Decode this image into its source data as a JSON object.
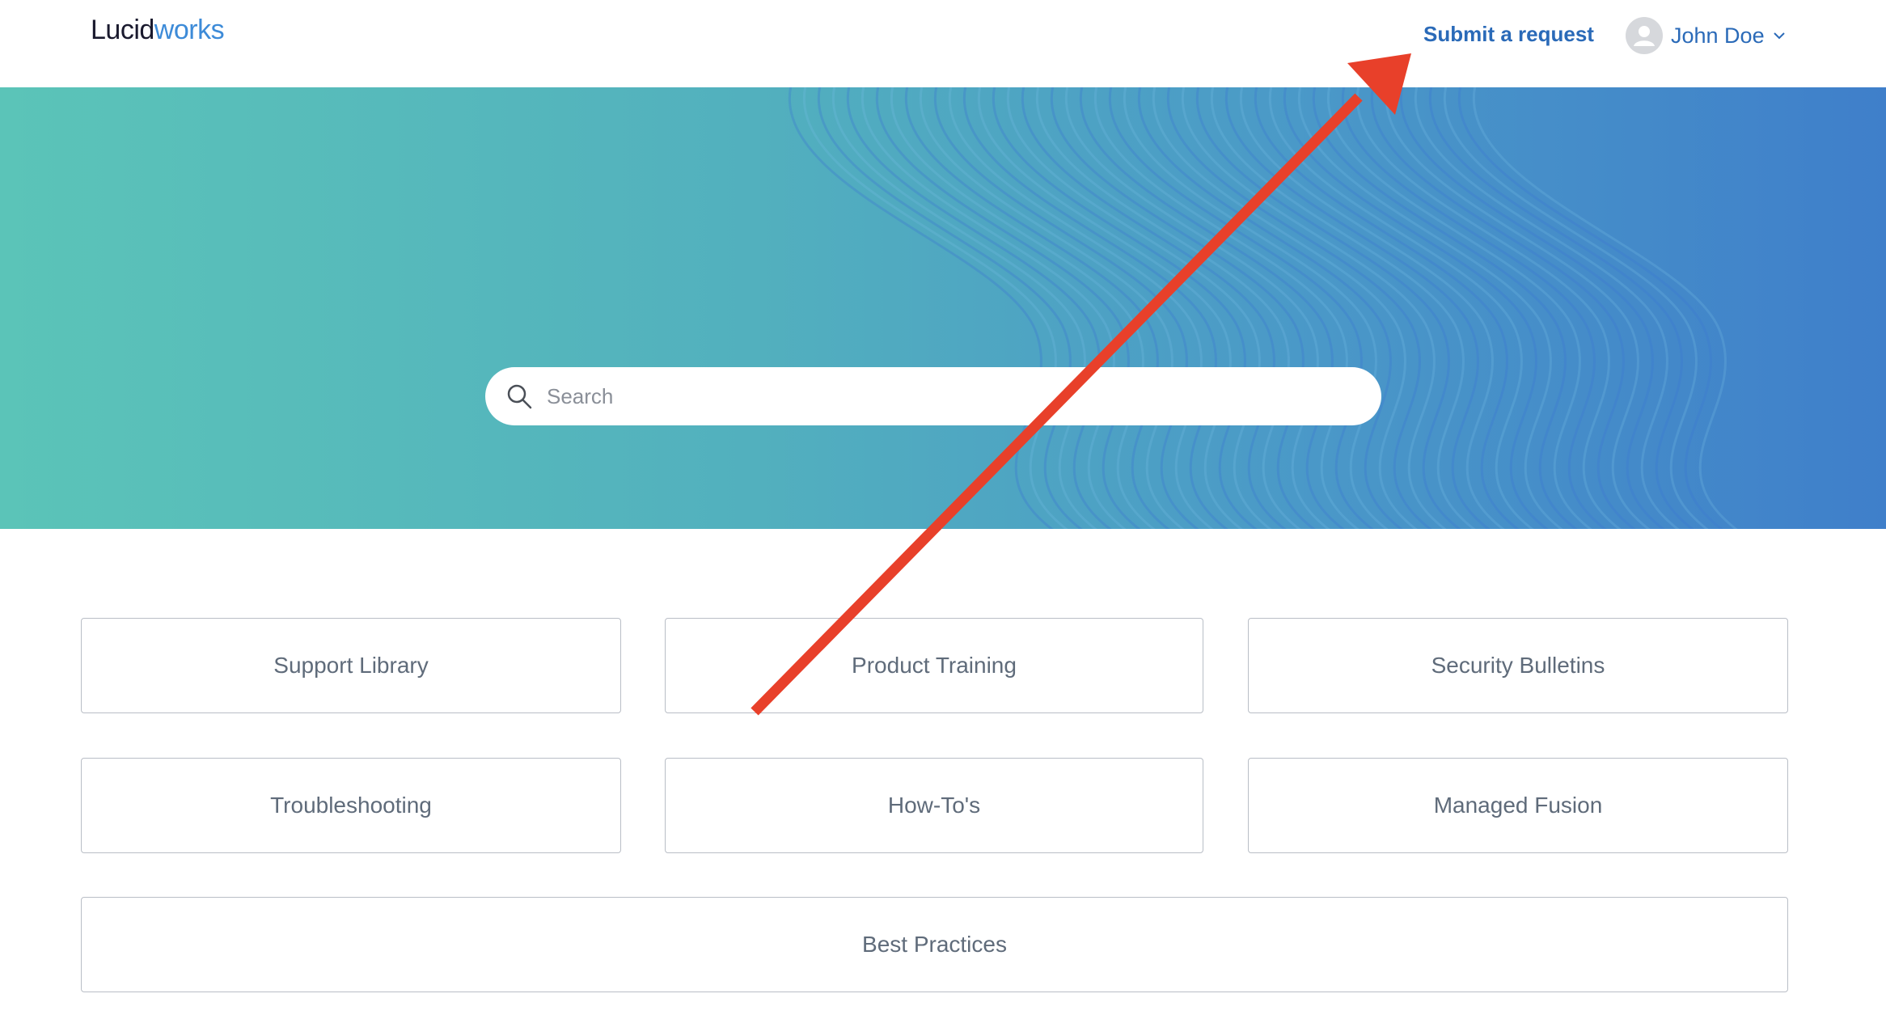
{
  "header": {
    "logo_part1": "Lucid",
    "logo_part2": "works",
    "submit_label": "Submit a request",
    "user_name": "John Doe",
    "user_icon": "person-icon",
    "dropdown_icon": "chevron-down-icon"
  },
  "hero": {
    "search_placeholder": "Search",
    "search_icon": "magnifier-icon"
  },
  "categories": [
    "Support Library",
    "Product Training",
    "Security Bulletins",
    "Troubleshooting",
    "How-To's",
    "Managed Fusion",
    "Best Practices"
  ],
  "colors": {
    "brand_dark": "#1a1a2e",
    "brand_blue": "#3d8bd8",
    "link_blue": "#2a6ab8",
    "hero_start": "#5bc4b8",
    "hero_end": "#3f7fca",
    "annotation_arrow": "#e8402a"
  }
}
